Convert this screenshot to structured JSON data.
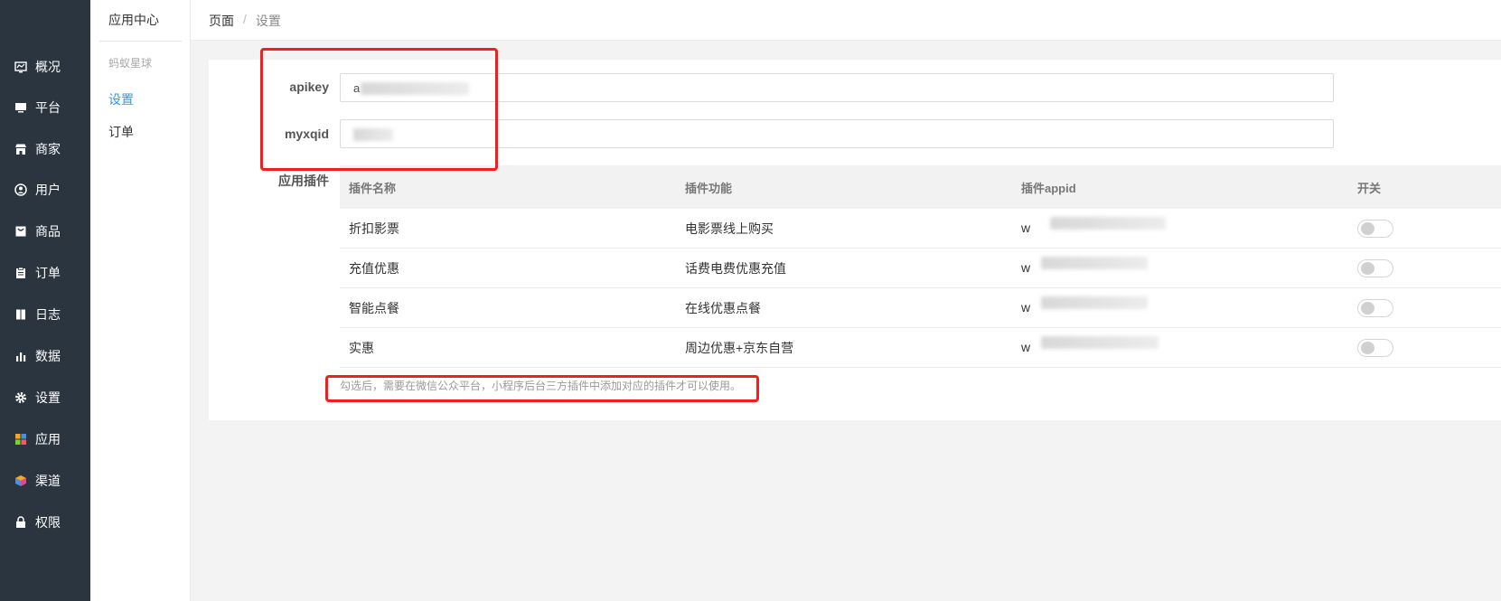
{
  "nav": {
    "items": [
      {
        "label": "概况",
        "icon": "dashboard-icon"
      },
      {
        "label": "平台",
        "icon": "monitor-icon"
      },
      {
        "label": "商家",
        "icon": "store-icon"
      },
      {
        "label": "用户",
        "icon": "user-icon"
      },
      {
        "label": "商品",
        "icon": "bag-icon"
      },
      {
        "label": "订单",
        "icon": "clipboard-icon"
      },
      {
        "label": "日志",
        "icon": "book-icon"
      },
      {
        "label": "数据",
        "icon": "bar-chart-icon"
      },
      {
        "label": "设置",
        "icon": "gear-icon"
      },
      {
        "label": "应用",
        "icon": "apps-grid-icon"
      },
      {
        "label": "渠道",
        "icon": "cube-icon"
      },
      {
        "label": "权限",
        "icon": "lock-icon"
      }
    ]
  },
  "submenu": {
    "title": "应用中心",
    "group": "蚂蚁星球",
    "links": [
      {
        "label": "设置",
        "active": true
      },
      {
        "label": "订单",
        "active": false
      }
    ]
  },
  "breadcrumb": {
    "home": "页面",
    "separator": "/",
    "current": "设置"
  },
  "form": {
    "apikey_label": "apikey",
    "apikey_value": "a",
    "myxqid_label": "myxqid",
    "myxqid_value": "",
    "plugins_label": "应用插件"
  },
  "table": {
    "headers": [
      "插件名称",
      "插件功能",
      "插件appid",
      "开关"
    ],
    "rows": [
      {
        "name": "折扣影票",
        "func": "电影票线上购买",
        "appid_prefix": "w",
        "enabled": false
      },
      {
        "name": "充值优惠",
        "func": "话费电费优惠充值",
        "appid_prefix": "w",
        "enabled": false
      },
      {
        "name": "智能点餐",
        "func": "在线优惠点餐",
        "appid_prefix": "w",
        "enabled": false
      },
      {
        "name": "实惠",
        "func": "周边优惠+京东自营",
        "appid_prefix": "w",
        "enabled": false
      }
    ]
  },
  "hint": "勾选后，需要在微信公众平台，小程序后台三方插件中添加对应的插件才可以使用。",
  "colors": {
    "sidebar_bg": "#2a3540",
    "accent": "#3a97d4",
    "annotation": "#f21f1f"
  }
}
